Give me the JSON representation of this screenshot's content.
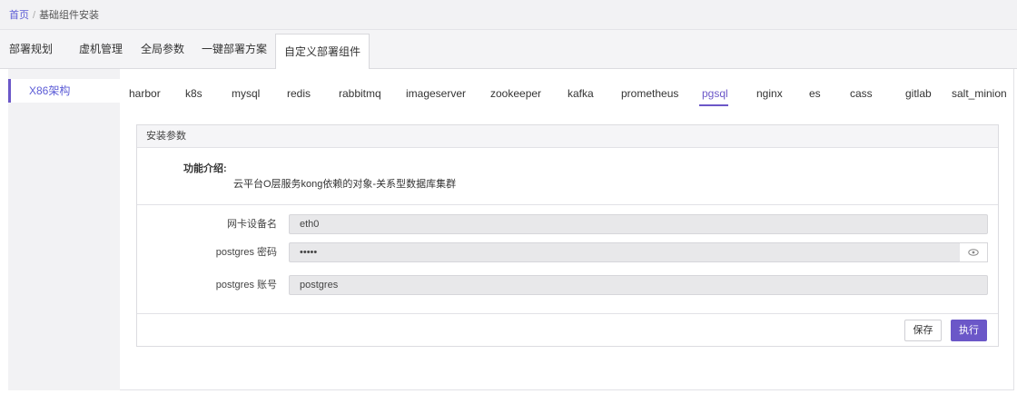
{
  "breadcrumb": {
    "home": "首页",
    "separator": "/",
    "current": "基础组件安装"
  },
  "top_tabs": [
    {
      "label": "部署规划",
      "active": false
    },
    {
      "label": "虚机管理",
      "active": false
    },
    {
      "label": "全局参数",
      "active": false
    },
    {
      "label": "一键部署方案",
      "active": false
    },
    {
      "label": "自定义部署组件",
      "active": true
    }
  ],
  "sidebar": {
    "items": [
      {
        "label": "X86架构",
        "active": true
      }
    ]
  },
  "component_tabs": [
    "harbor",
    "k8s",
    "mysql",
    "redis",
    "rabbitmq",
    "imageserver",
    "zookeeper",
    "kafka",
    "prometheus",
    "pgsql",
    "nginx",
    "es",
    "cass",
    "gitlab",
    "salt_minion"
  ],
  "active_component": "pgsql",
  "card": {
    "title": "安装参数",
    "func_title": "功能介绍:",
    "func_desc": "云平台O层服务kong依赖的对象-关系型数据库集群",
    "fields": [
      {
        "label": "网卡设备名",
        "value": "eth0"
      },
      {
        "label": "postgres 密码",
        "value": "•••••"
      },
      {
        "label": "postgres 账号",
        "value": "postgres"
      }
    ],
    "password_toggle_icon": "eye-icon"
  },
  "buttons": {
    "save": "保存",
    "execute": "执行"
  },
  "colors": {
    "accent": "#6b57c8",
    "link": "#5b5bd6",
    "input_bg": "#e8e8ea"
  }
}
